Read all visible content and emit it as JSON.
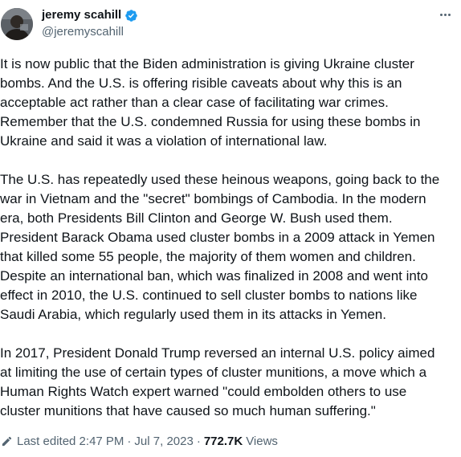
{
  "author": {
    "display_name": "jeremy scahill",
    "handle": "@jeremyscahill",
    "verified": true
  },
  "tweet": {
    "paragraphs": [
      "It is now public that the Biden administration is giving Ukraine cluster\nbombs. And the U.S. is offering risible caveats about why this is an\nacceptable act rather than a clear case of facilitating war crimes.\nRemember that the U.S. condemned Russia for using these bombs in\nUkraine and said it was a violation of international law.",
      "The U.S. has repeatedly used these heinous weapons, going back to the\nwar in Vietnam and the \"secret\" bombings of Cambodia. In the modern\nera, both Presidents Bill Clinton and George W. Bush used them.\nPresident Barack Obama used cluster bombs in a 2009 attack in Yemen\nthat killed some 55 people, the majority of them women and children.\nDespite an international ban, which was finalized in 2008 and went into\neffect in 2010, the U.S. continued to sell cluster bombs to nations like\nSaudi Arabia, which regularly used them in its attacks in Yemen.",
      "In 2017, President Donald Trump reversed an internal U.S. policy aimed\nat limiting the use of certain types of cluster munitions, a move which a\nHuman Rights Watch expert warned \"could embolden others to use\ncluster munitions that have caused so much human suffering.\""
    ]
  },
  "footer": {
    "edited_label": "Last edited 2:47 PM",
    "separator": "·",
    "date": "Jul 7, 2023",
    "views_count": "772.7K",
    "views_label": "Views"
  },
  "icons": {
    "verified": "verified-badge-icon",
    "more": "more-icon",
    "edit": "pencil-icon"
  },
  "colors": {
    "text": "#0f1419",
    "secondary": "#536471",
    "verified": "#1d9bf0"
  }
}
